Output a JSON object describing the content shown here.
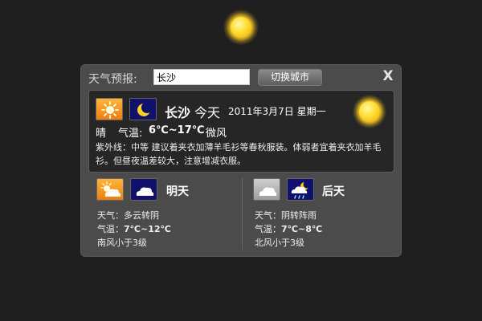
{
  "header": {
    "label": "天气预报:",
    "city_value": "长沙",
    "switch_label": "切换城市",
    "close_label": "X"
  },
  "today": {
    "city": "长沙",
    "day": "今天",
    "date": "2011年3月7日 星期一",
    "condition": "晴",
    "temp_label": "气温:",
    "temp": "6℃~17℃",
    "wind": "微风",
    "uv_text": "紫外线：中等  建议着夹衣加薄羊毛衫等春秋服装。体弱者宜着夹衣加羊毛衫。但昼夜温差较大，注意增减衣服。",
    "icons": [
      "sun-icon",
      "moon-icon"
    ]
  },
  "tomorrow": {
    "label": "明天",
    "weather": "天气：多云转阴",
    "temp_prefix": "气温：",
    "temp": "7℃~12℃",
    "wind": "南风小于3级",
    "icons": [
      "partly-cloudy-icon",
      "cloud-icon"
    ]
  },
  "day_after": {
    "label": "后天",
    "weather": "天气：阴转阵雨",
    "temp_prefix": "气温：",
    "temp": "7℃~8℃",
    "wind": "北风小于3级",
    "icons": [
      "cloud-icon",
      "night-shower-icon"
    ]
  },
  "colors": {
    "background": "#1f1f1f",
    "widget": "#4b4b4b",
    "panel": "#262626",
    "orange_icon": "#ee7d10",
    "navy_icon": "#10106d"
  }
}
